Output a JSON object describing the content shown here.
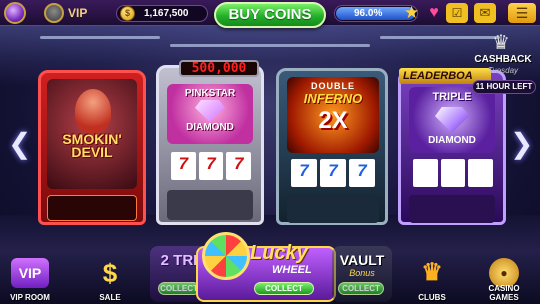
{
  "header": {
    "vip_label": "VIP",
    "coins": "1,167,500",
    "buy_coins_label": "BUY COINS",
    "level_percent": "96.0%",
    "level_fraction": 0.96,
    "icons": [
      "vip-badge-icon",
      "avatar",
      "coin-icon",
      "star-icon",
      "heart-gift-icon",
      "checklist-icon",
      "mail-icon",
      "menu-icon"
    ]
  },
  "machines": [
    {
      "name": "Smokin' Devil",
      "title": "SMOKIN' DEVIL",
      "reels": []
    },
    {
      "name": "Pinkstar Diamond",
      "jackpot": "500,000",
      "title": "PINKSTAR",
      "subtitle": "DIAMOND",
      "reels": [
        "7",
        "7",
        "7"
      ]
    },
    {
      "name": "Double Inferno 2x",
      "title": "DOUBLE",
      "name_line": "INFERNO",
      "multiplier": "2X",
      "reels": [
        "7",
        "7",
        "7"
      ]
    },
    {
      "name": "Triple Diamond",
      "ribbon": "LEADERBOA",
      "title": "TRIPLE",
      "subtitle": "DIAMOND",
      "reels": []
    }
  ],
  "cashback": {
    "title": "CASHBACK",
    "subtitle": "Tuesday",
    "timer": "11 HOUR LEFT"
  },
  "bottom": {
    "vip_room": "VIP ROOM",
    "vip_icon_text": "VIP",
    "sale": "SALE",
    "clubs": "CLUBS",
    "casino_games": "CASINO GAMES"
  },
  "promos": {
    "triple_title": "2 TRI",
    "lucky_title": "Lucky",
    "lucky_sub": "WHEEL",
    "vault_title": "VAULT",
    "vault_sub": "Bonus",
    "collect": "COLLECT"
  },
  "colors": {
    "buy_coins_green": "#25b02a",
    "accent_gold": "#f2d27a",
    "level_blue": "#2050c8"
  }
}
